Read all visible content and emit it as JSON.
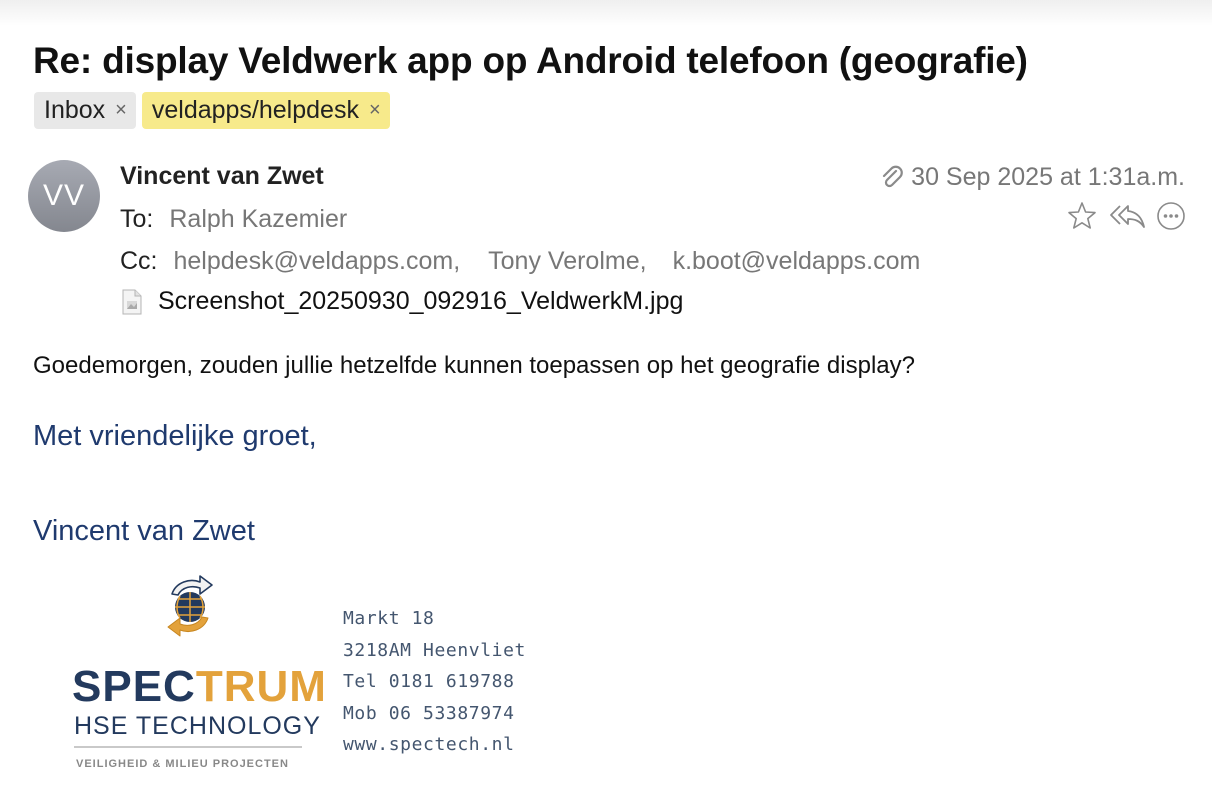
{
  "message": {
    "subject": "Re: display Veldwerk app op Android telefoon (geografie)",
    "labels": [
      {
        "text": "Inbox",
        "color": "#e8e8e8"
      },
      {
        "text": "veldapps/helpdesk",
        "color": "#f7ea8b"
      }
    ],
    "label_remove_glyph": "×",
    "avatar_initials": "VV",
    "sender": "Vincent van Zwet",
    "date": "30 Sep 2025 at 1:31a.m.",
    "to_label": "To:",
    "to": "Ralph Kazemier",
    "cc_label": "Cc:",
    "cc": [
      "helpdesk@veldapps.com,",
      "Tony Verolme,",
      "k.boot@veldapps.com"
    ],
    "attachment": "Screenshot_20250930_092916_VeldwerkM.jpg",
    "icons": [
      "paperclip-icon",
      "star-icon",
      "reply-all-icon",
      "more-icon",
      "image-file-icon"
    ]
  },
  "body": {
    "text": "Goedemorgen, zouden jullie hetzelfde kunnen toepassen op het geografie display?",
    "greeting": "Met vriendelijke groet,",
    "signature_name": "Vincent van Zwet"
  },
  "signature": {
    "logo_word_1": "SPEC",
    "logo_word_2": "TRUM",
    "logo_sub": "HSE TECHNOLOGY",
    "logo_tagline": "VEILIGHEID & MILIEU PROJECTEN",
    "contact": [
      "Markt 18",
      "3218AM Heenvliet",
      "Tel 0181 619788",
      "Mob 06 53387974",
      "www.spectech.nl"
    ],
    "brand_colors": {
      "navy": "#233a5e",
      "orange": "#e3a23b"
    }
  },
  "colors": {
    "link_blue": "#1f3a6e",
    "muted": "#777777"
  }
}
